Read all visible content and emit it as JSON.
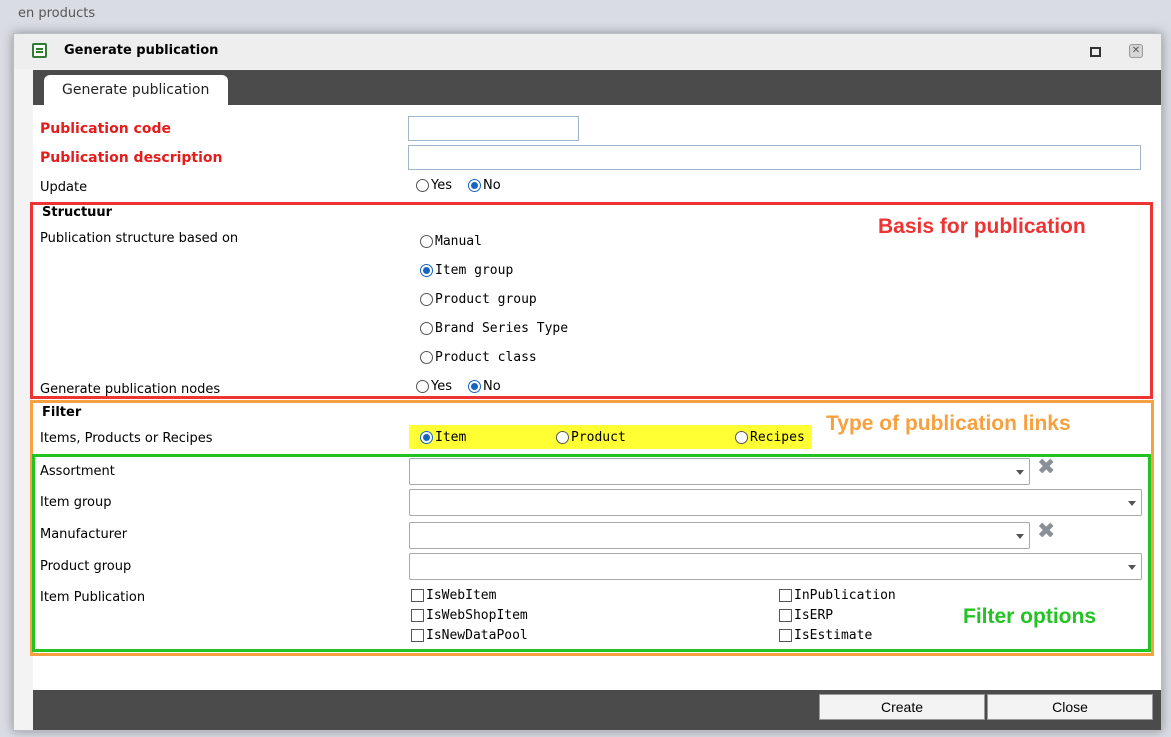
{
  "background": {
    "title": "en products"
  },
  "dialog": {
    "title": "Generate publication",
    "tab_label": "Generate publication"
  },
  "form": {
    "publication_code_label": "Publication code",
    "publication_code_value": "",
    "publication_description_label": "Publication description",
    "publication_description_value": "",
    "update_label": "Update",
    "update_options": {
      "yes": "Yes",
      "no": "No",
      "selected": "No"
    },
    "structuur": {
      "heading": "Structuur",
      "structure_label": "Publication structure based on",
      "options": [
        "Manual",
        "Item group",
        "Product group",
        "Brand Series Type",
        "Product class"
      ],
      "selected": "Item group",
      "nodes_label": "Generate publication nodes",
      "nodes_options": {
        "yes": "Yes",
        "no": "No",
        "selected": "No"
      }
    },
    "filter": {
      "heading": "Filter",
      "type_label": "Items, Products or Recipes",
      "type_options": [
        "Item",
        "Product",
        "Recipes"
      ],
      "type_selected": "Item",
      "assortment_label": "Assortment",
      "item_group_label": "Item group",
      "manufacturer_label": "Manufacturer",
      "product_group_label": "Product group",
      "item_publication_label": "Item Publication",
      "checkboxes_left": [
        "IsWebItem",
        "IsWebShopItem",
        "IsNewDataPool"
      ],
      "checkboxes_right": [
        "InPublication",
        "IsERP",
        "IsEstimate"
      ]
    }
  },
  "annotations": {
    "basis": "Basis for publication",
    "type_links": "Type of publication links",
    "filter_options": "Filter options"
  },
  "colors": {
    "red_box": "#ee3333",
    "orange_box": "#f7a040",
    "green_box": "#22c322",
    "highlight": "#ffff33"
  },
  "footer": {
    "create": "Create",
    "close": "Close"
  }
}
